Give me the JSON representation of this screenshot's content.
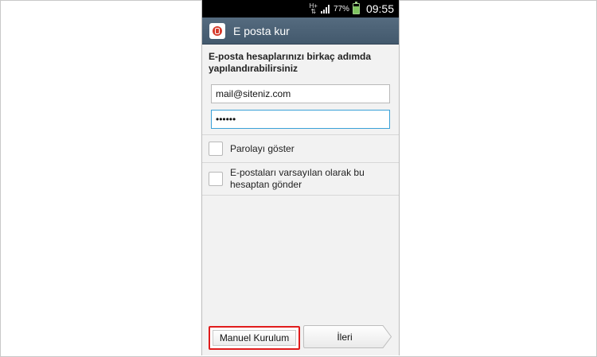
{
  "status_bar": {
    "network": "H+",
    "battery_percent": "77%",
    "battery_level": 0.77,
    "time": "09:55"
  },
  "action_bar": {
    "title": "E posta kur",
    "icon": "email-app-icon"
  },
  "form": {
    "instructions": "E-posta hesaplarınızı birkaç adımda yapılandırabilirsiniz",
    "email_value": "mail@siteniz.com",
    "password_value": "••••••"
  },
  "options": {
    "show_password_label": "Parolayı göster",
    "default_account_label": "E-postaları varsayılan olarak bu hesaptan gönder"
  },
  "buttons": {
    "manual_setup": "Manuel Kurulum",
    "next": "İleri"
  },
  "colors": {
    "action_bar": "#4d6377",
    "highlight": "#e01c1c",
    "focus": "#3aa1d8"
  }
}
